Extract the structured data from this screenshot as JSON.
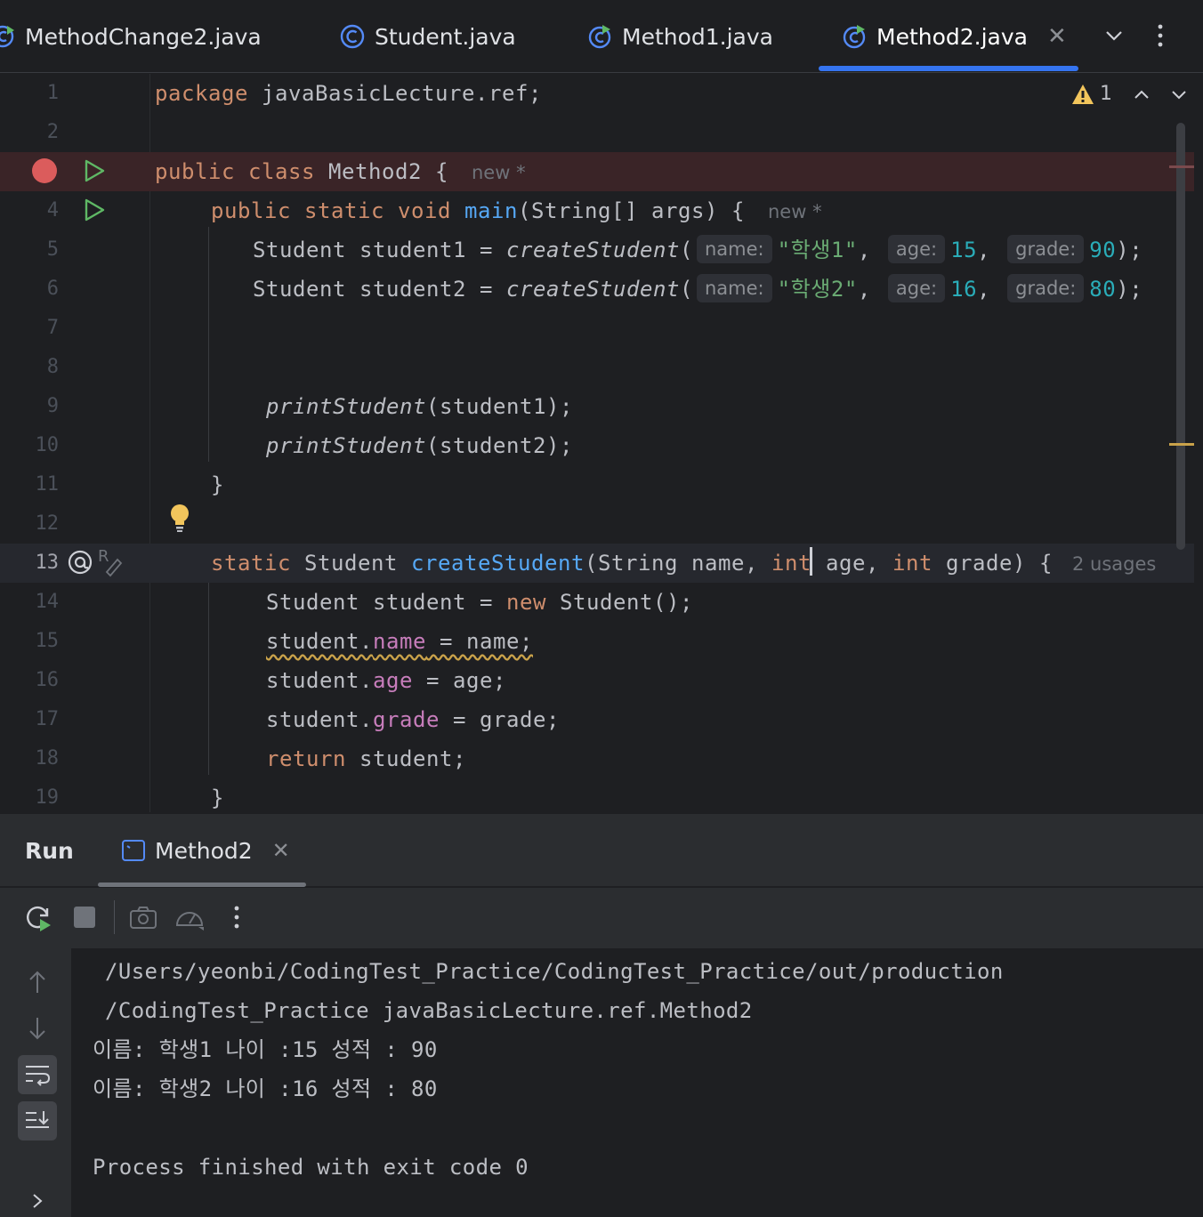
{
  "tabs": [
    {
      "name": "MethodChange2.java",
      "active": false
    },
    {
      "name": "Student.java",
      "active": false
    },
    {
      "name": "Method1.java",
      "active": false
    },
    {
      "name": "Method2.java",
      "active": true
    }
  ],
  "editor": {
    "warning_count": "1",
    "line_numbers": [
      "1",
      "2",
      "3",
      "4",
      "5",
      "6",
      "7",
      "8",
      "9",
      "10",
      "11",
      "12",
      "13",
      "14",
      "15",
      "16",
      "17",
      "18",
      "19"
    ],
    "lines": {
      "l1": {
        "kw": "package",
        "rest": " javaBasicLecture.ref;"
      },
      "l3": {
        "kw": "public class",
        "name": " Method2 {",
        "inlay": "new *"
      },
      "l4": {
        "kw": "public static void",
        "fn": "main",
        "rest": "(String[] args) {",
        "inlay": "new *"
      },
      "l5": {
        "decl": "Student student1 = ",
        "call": "createStudent",
        "open": "(",
        "h_name": "name:",
        "v_name": "\"학생1\"",
        "h_age": "age:",
        "v_age": "15",
        "h_grade": "grade:",
        "v_grade": "90",
        "close": ");"
      },
      "l6": {
        "decl": "Student student2 = ",
        "call": "createStudent",
        "open": "(",
        "h_name": "name:",
        "v_name": "\"학생2\"",
        "h_age": "age:",
        "v_age": "16",
        "h_grade": "grade:",
        "v_grade": "80",
        "close": ");"
      },
      "l9": {
        "call": "printStudent",
        "rest": "(student1);"
      },
      "l10": {
        "call": "printStudent",
        "rest": "(student2);"
      },
      "l11": {
        "text": "}"
      },
      "l13": {
        "kw1": "static",
        "type": " Student ",
        "fn": "createStudent",
        "p1": "(String name, ",
        "kw2": "int",
        "p2": " age, ",
        "kw3": "int",
        "p3": " grade) {",
        "usages": "2 usages"
      },
      "l14": {
        "a": "Student student = ",
        "kw": "new",
        "b": " Student();"
      },
      "l15": {
        "obj": "student.",
        "fld": "name",
        "rest": " = name;"
      },
      "l16": {
        "obj": "student.",
        "fld": "age",
        "rest": " = age;"
      },
      "l17": {
        "obj": "student.",
        "fld": "grade",
        "rest": " = grade;"
      },
      "l18": {
        "kw": "return",
        "rest": " student;"
      },
      "l19": {
        "text": "}"
      }
    }
  },
  "run_panel": {
    "title": "Run",
    "tab_label": "Method2",
    "console": [
      "/Users/yeonbi/CodingTest_Practice/CodingTest_Practice/out/production",
      "/CodingTest_Practice javaBasicLecture.ref.Method2",
      "이름: 학생1 나이 :15 성적 : 90",
      "이름: 학생2 나이 :16 성적 : 80",
      "",
      "Process finished with exit code 0"
    ]
  },
  "colors": {
    "accent": "#3574f0",
    "keyword": "#cf8e6d",
    "function": "#56a8f5",
    "string": "#6aab73",
    "number": "#2aacb8",
    "field": "#c77dbb",
    "breakpoint": "#db5c5c",
    "run": "#5fb865"
  },
  "icons": {
    "tab_file": "java-class-icon",
    "tab_bar": [
      "chevron-down-icon",
      "more-vertical-icon"
    ],
    "gutter": [
      "breakpoint-icon",
      "run-gutter-icon",
      "lightbulb-icon",
      "override-icon"
    ],
    "run_toolbar": [
      "rerun-icon",
      "stop-icon",
      "camera-icon",
      "profiler-icon",
      "more-vertical-icon"
    ],
    "console_side": [
      "arrow-up-icon",
      "arrow-down-icon",
      "soft-wrap-icon",
      "scroll-to-end-icon",
      "chevron-right-icon"
    ]
  }
}
